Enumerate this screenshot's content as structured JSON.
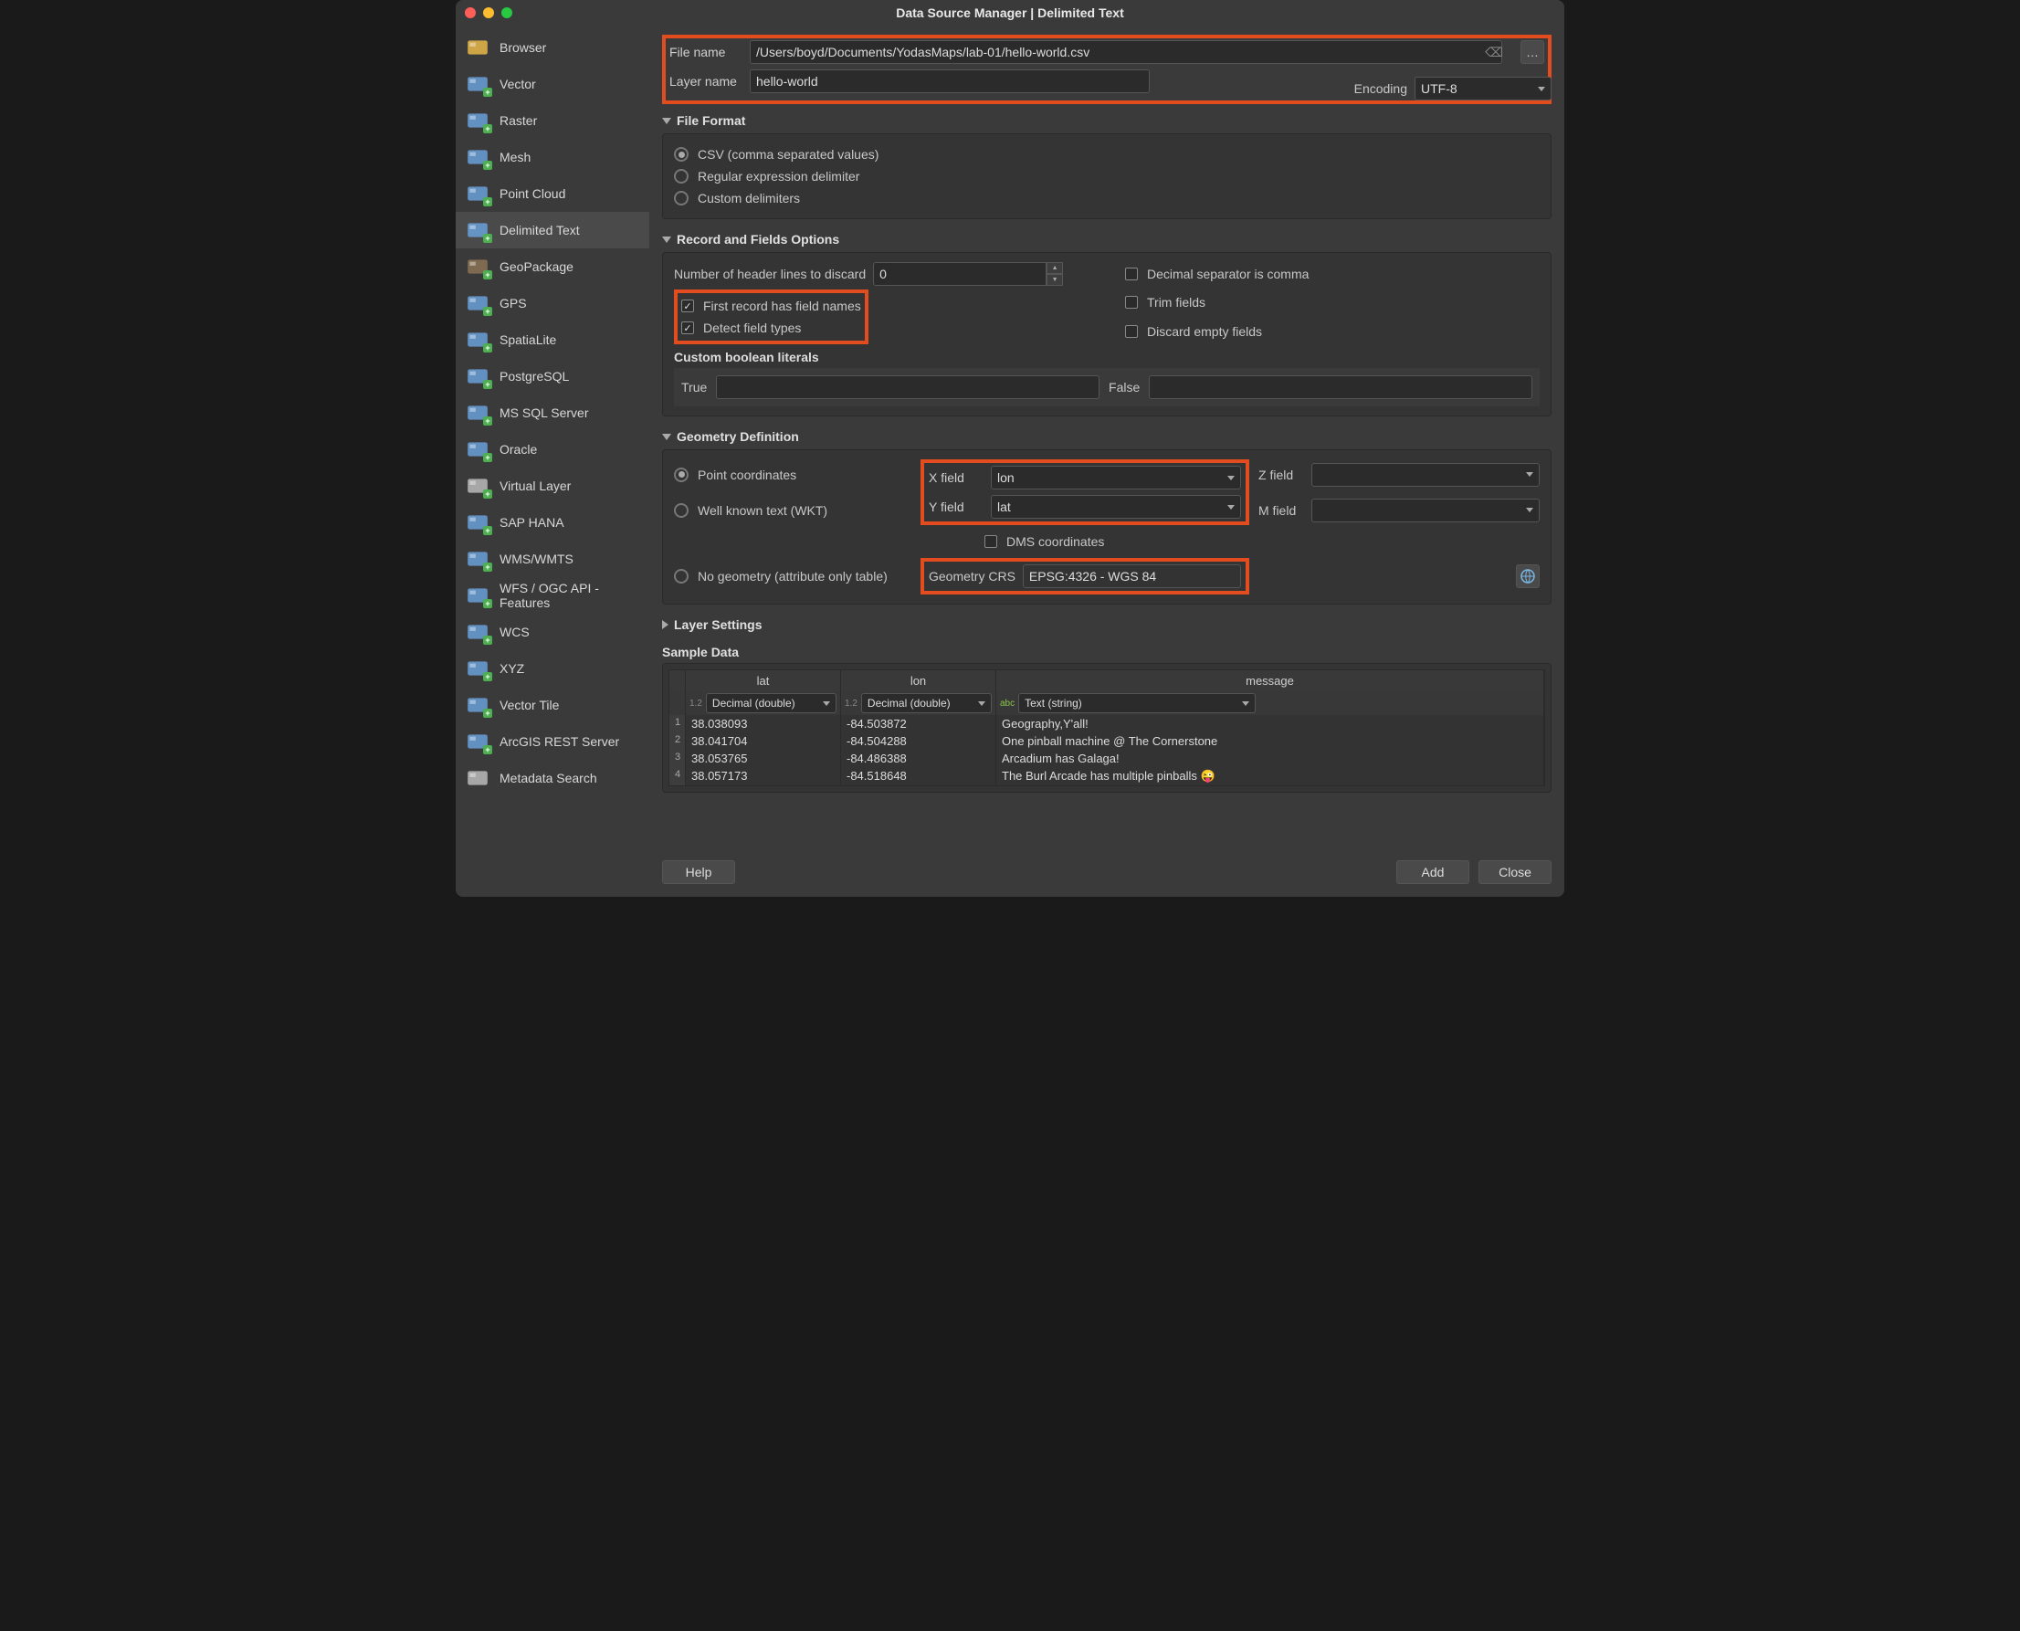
{
  "window_title": "Data Source Manager | Delimited Text",
  "sidebar": {
    "items": [
      {
        "label": "Browser",
        "id": "browser"
      },
      {
        "label": "Vector",
        "id": "vector"
      },
      {
        "label": "Raster",
        "id": "raster"
      },
      {
        "label": "Mesh",
        "id": "mesh"
      },
      {
        "label": "Point Cloud",
        "id": "pointcloud"
      },
      {
        "label": "Delimited Text",
        "id": "delimited",
        "selected": true
      },
      {
        "label": "GeoPackage",
        "id": "geopackage"
      },
      {
        "label": "GPS",
        "id": "gps"
      },
      {
        "label": "SpatiaLite",
        "id": "spatialite"
      },
      {
        "label": "PostgreSQL",
        "id": "postgresql"
      },
      {
        "label": "MS SQL Server",
        "id": "mssql"
      },
      {
        "label": "Oracle",
        "id": "oracle"
      },
      {
        "label": "Virtual Layer",
        "id": "virtual"
      },
      {
        "label": "SAP HANA",
        "id": "saphana"
      },
      {
        "label": "WMS/WMTS",
        "id": "wms"
      },
      {
        "label": "WFS / OGC API - Features",
        "id": "wfs"
      },
      {
        "label": "WCS",
        "id": "wcs"
      },
      {
        "label": "XYZ",
        "id": "xyz"
      },
      {
        "label": "Vector Tile",
        "id": "vectortile"
      },
      {
        "label": "ArcGIS REST Server",
        "id": "arcgis"
      },
      {
        "label": "Metadata Search",
        "id": "metadata"
      }
    ]
  },
  "file": {
    "label": "File name",
    "value": "/Users/boyd/Documents/YodasMaps/lab-01/hello-world.csv"
  },
  "layer": {
    "label": "Layer name",
    "value": "hello-world"
  },
  "encoding": {
    "label": "Encoding",
    "value": "UTF-8"
  },
  "sections": {
    "file_format": {
      "title": "File Format",
      "options": {
        "csv": "CSV (comma separated values)",
        "regex": "Regular expression delimiter",
        "custom": "Custom delimiters"
      },
      "selected": "csv"
    },
    "records": {
      "title": "Record and Fields Options",
      "header_lines_label": "Number of header lines to discard",
      "header_lines_value": "0",
      "first_record": "First record has field names",
      "detect_types": "Detect field types",
      "decimal_comma": "Decimal separator is comma",
      "trim": "Trim fields",
      "discard_empty": "Discard empty fields",
      "custom_bool": "Custom boolean literals",
      "true_label": "True",
      "false_label": "False"
    },
    "geometry": {
      "title": "Geometry Definition",
      "point": "Point coordinates",
      "wkt": "Well known text (WKT)",
      "nogeo": "No geometry (attribute only table)",
      "x_label": "X field",
      "x_value": "lon",
      "y_label": "Y field",
      "y_value": "lat",
      "z_label": "Z field",
      "m_label": "M field",
      "dms": "DMS coordinates",
      "crs_label": "Geometry CRS",
      "crs_value": "EPSG:4326 - WGS 84"
    },
    "layersettings": {
      "title": "Layer Settings"
    }
  },
  "sample": {
    "title": "Sample Data",
    "columns": [
      "lat",
      "lon",
      "message"
    ],
    "types": [
      "Decimal (double)",
      "Decimal (double)",
      "Text (string)"
    ],
    "type_prefix_num": "1.2",
    "type_prefix_txt": "abc",
    "rows": [
      {
        "n": "1",
        "lat": "38.038093",
        "lon": "-84.503872",
        "message": "Geography,Y'all!"
      },
      {
        "n": "2",
        "lat": "38.041704",
        "lon": "-84.504288",
        "message": "One pinball machine @ The Cornerstone"
      },
      {
        "n": "3",
        "lat": "38.053765",
        "lon": "-84.486388",
        "message": "Arcadium has Galaga!"
      },
      {
        "n": "4",
        "lat": "38.057173",
        "lon": "-84.518648",
        "message": "The Burl Arcade has multiple pinballs 😜"
      }
    ]
  },
  "buttons": {
    "help": "Help",
    "add": "Add",
    "close": "Close"
  }
}
